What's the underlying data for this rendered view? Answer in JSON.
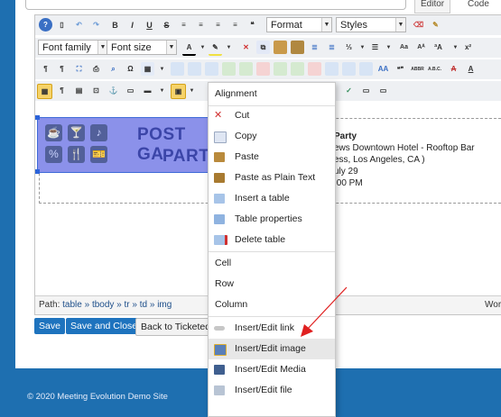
{
  "tabs": {
    "editor": "Editor",
    "code": "Code"
  },
  "toolbar": {
    "format": "Format",
    "styles": "Styles",
    "font_family": "Font family",
    "font_size": "Font size",
    "bold": "B",
    "italic": "I",
    "underline": "U",
    "strike": "S",
    "letter_a": "A"
  },
  "banner": {
    "line1": "POST GA",
    "line2": "PART"
  },
  "event": {
    "title": "Party",
    "venue": "ews Downtown Hotel - Rooftop Bar",
    "address": "ess, Los Angeles, CA )",
    "date": "uly 29",
    "time": ":00 PM"
  },
  "path": {
    "label": "Path:",
    "value": "table » tbody » tr » td » img",
    "word_count": "Wor"
  },
  "buttons": {
    "save": "Save",
    "save_close": "Save and Close",
    "back": "Back to Ticketed Ev"
  },
  "footer": "© 2020 Meeting Evolution Demo Site",
  "context_menu": {
    "alignment": "Alignment",
    "cut": "Cut",
    "copy": "Copy",
    "paste": "Paste",
    "paste_plain": "Paste as Plain Text",
    "insert_table": "Insert a table",
    "table_props": "Table properties",
    "delete_table": "Delete table",
    "cell": "Cell",
    "row": "Row",
    "column": "Column",
    "insert_link": "Insert/Edit link",
    "insert_image": "Insert/Edit image",
    "insert_media": "Insert/Edit Media",
    "insert_file": "Insert/Edit file"
  },
  "colors": {
    "accent": "#1e73be",
    "banner": "#8b91ea",
    "arrow": "#e02020"
  }
}
